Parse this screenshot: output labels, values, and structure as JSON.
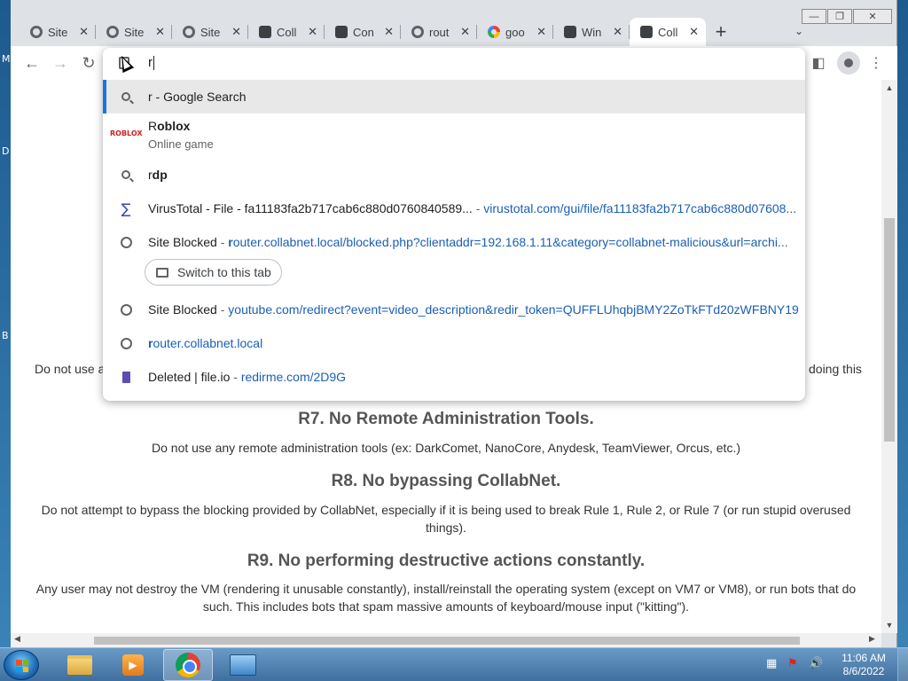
{
  "desktop": {
    "letters": [
      "M",
      "D",
      "B"
    ]
  },
  "window_controls": {
    "minimize": "—",
    "restore": "❐",
    "close": "✕"
  },
  "tabs": [
    {
      "title": "Site",
      "icon": "globe-icon"
    },
    {
      "title": "Site",
      "icon": "globe-icon"
    },
    {
      "title": "Site",
      "icon": "globe-icon"
    },
    {
      "title": "Coll",
      "icon": "collabnet-icon"
    },
    {
      "title": "Con",
      "icon": "collabnet-icon"
    },
    {
      "title": "rout",
      "icon": "globe-icon"
    },
    {
      "title": "goo",
      "icon": "google-icon"
    },
    {
      "title": "Win",
      "icon": "collabnet-icon"
    },
    {
      "title": "Coll",
      "icon": "collabnet-icon",
      "active": true
    }
  ],
  "toolbar": {
    "back": "←",
    "forward": "→",
    "reload": "↻",
    "menu": "⋮",
    "sidepanel": "◧"
  },
  "omnibox": {
    "typed_text": "r",
    "suggestions": [
      {
        "type": "search",
        "main": "r - Google Search"
      },
      {
        "type": "site",
        "bold_prefix": "R",
        "main_rest": "oblox",
        "subtitle": "Online game"
      },
      {
        "type": "search",
        "prefix": "r",
        "main_bold": "dp"
      },
      {
        "type": "history",
        "title": "VirusTotal - File - fa11183fa2b717cab6c880d0760840589...",
        "url": "virustotal.com/gui/file/fa11183fa2b717cab6c880d07608..."
      },
      {
        "type": "tab",
        "title": "Site Blocked",
        "url_bold": "r",
        "url_rest": "outer.collabnet.local/blocked.php?clientaddr=192.168.1.11&category=collabnet-malicious&url=archi..."
      },
      {
        "type": "history",
        "title": "Site Blocked",
        "url": "youtube.com/redirect?event=video_description&redir_token=QUFFLUhqbjBMY2ZoTkFTd20zWFBNY19..."
      },
      {
        "type": "url",
        "url_bold": "r",
        "url_rest": "outer.collabnet.local"
      },
      {
        "type": "history",
        "title": "Deleted | file.io",
        "url": "redirme.com/2D9G"
      }
    ],
    "switch_tab_label": "Switch to this tab",
    "roblox_logo": "ROBLOX"
  },
  "page": {
    "partial_left": "Do not use a",
    "partial_right": "doing this",
    "rules": [
      {
        "heading": "R7. No Remote Administration Tools.",
        "text": "Do not use any remote administration tools (ex: DarkComet, NanoCore, Anydesk, TeamViewer, Orcus, etc.)"
      },
      {
        "heading": "R8. No bypassing CollabNet.",
        "text": "Do not attempt to bypass the blocking provided by CollabNet, especially if it is being used to break Rule 1, Rule 2, or Rule 7 (or run stupid overused things)."
      },
      {
        "heading": "R9. No performing destructive actions constantly.",
        "text": "Any user may not destroy the VM (rendering it unusable constantly), install/reinstall the operating system (except on VM7 or VM8), or run bots that do such. This includes bots that spam massive amounts of keyboard/mouse input (\"kitting\")."
      }
    ]
  },
  "taskbar": {
    "clock_time": "11:06 AM",
    "clock_date": "8/6/2022"
  }
}
